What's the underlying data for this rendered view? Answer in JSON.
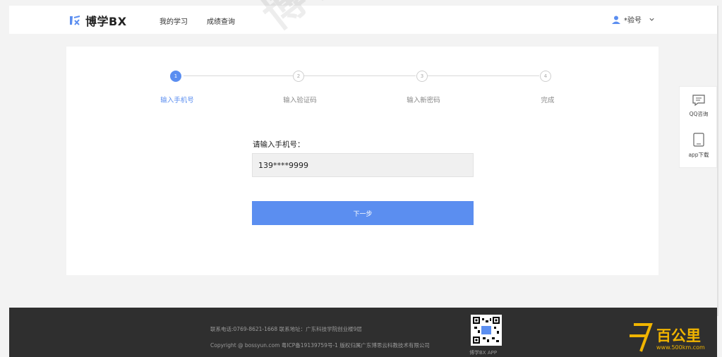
{
  "header": {
    "logo_text": "博学BX",
    "nav": [
      "我的学习",
      "成绩查询"
    ],
    "user_name": "*验号"
  },
  "steps": [
    {
      "num": "1",
      "label": "输入手机号",
      "active": true
    },
    {
      "num": "2",
      "label": "输入验证码",
      "active": false
    },
    {
      "num": "3",
      "label": "输入新密码",
      "active": false
    },
    {
      "num": "4",
      "label": "完成",
      "active": false
    }
  ],
  "form": {
    "label": "请输入手机号：",
    "phone_value": "139****9999",
    "next_label": "下一步"
  },
  "float_panel": {
    "qq_label": "QQ咨询",
    "app_label": "app下载"
  },
  "footer": {
    "contact": "联系电话:0769-8621-1668    联系地址：广东科技学院创业楼9层",
    "copyright": "Copyright @ bossyun.com 粤ICP备19139759号-1    版权归属广东博思云科教技术有限公司",
    "qr_label": "博学BX APP"
  },
  "watermark": {
    "diag_text": "博学",
    "brand_text": "百公里",
    "brand_url": "www.500km.com"
  },
  "colors": {
    "accent": "#5b8ef0",
    "footer_bg": "#2f2f2f",
    "brand": "#f0b400"
  }
}
